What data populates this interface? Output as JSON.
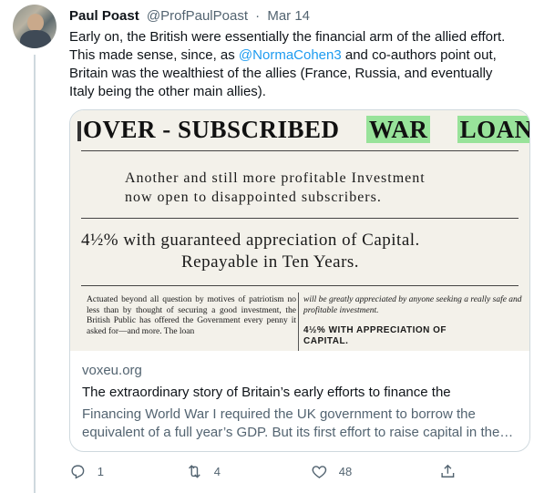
{
  "tweet": {
    "display_name": "Paul Poast",
    "handle": "@ProfPaulPoast",
    "separator": "·",
    "date": "Mar 14",
    "text_before_mention": "Early on, the British were essentially the financial arm of the allied effort. This made sense, since, as ",
    "mention": "@NormaCohen3",
    "text_after_mention": " and co-authors point out, Britain was the wealthiest of the allies (France, Russia, and eventually Italy being the other main allies)."
  },
  "card": {
    "image": {
      "headline_part1": "OVER - SUBSCRIBED",
      "headline_highlight1": "WAR",
      "headline_highlight2": "LOAN.",
      "sub_line1": "Another and still more profitable Investment",
      "sub_line2": "now open to disappointed subscribers.",
      "rate_line": "4½% with guaranteed appreciation of Capital.",
      "repay_line": "Repayable in Ten Years.",
      "col_left": "Actuated beyond all question by motives of patriotism no less than by thought of securing a good investment, the British Public has offered the Government every penny it asked for—and more. The loan",
      "col_right": "will be greatly appreciated by anyone seeking a really safe and profitable investment.",
      "col_right_head_line1": "4½% WITH APPRECIATION OF",
      "col_right_head_line2": "CAPITAL."
    },
    "domain": "voxeu.org",
    "title": "The extraordinary story of Britain’s early efforts to finance the",
    "description": "Financing World War I required the UK government to borrow the equivalent of a full year’s GDP. But its first effort to raise capital in the…"
  },
  "actions": {
    "reply_count": "1",
    "retweet_count": "4",
    "like_count": "48",
    "icons": [
      "reply-icon",
      "retweet-icon",
      "like-icon",
      "share-icon"
    ]
  },
  "colors": {
    "link": "#1d9bf0",
    "muted": "#536471",
    "highlight": "#98e39a",
    "border": "#cfd9de"
  }
}
